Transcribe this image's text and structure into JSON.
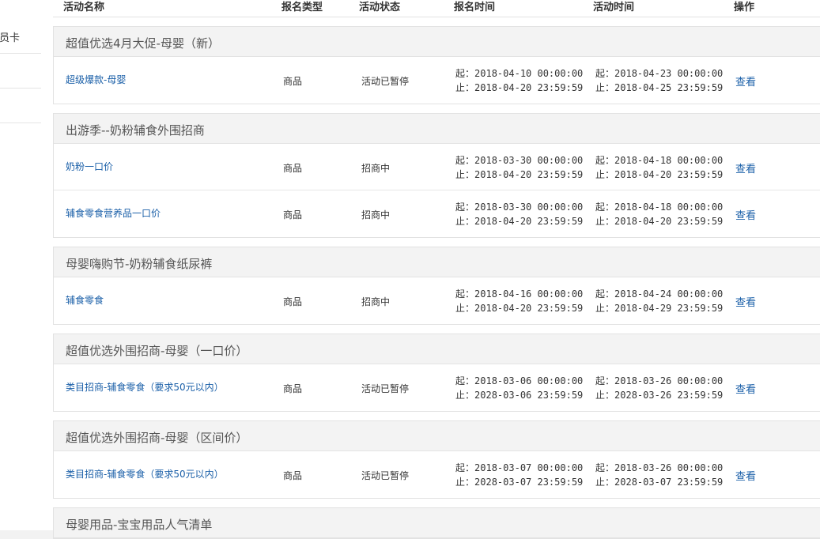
{
  "sidebar": {
    "items": [
      {
        "label": "会员卡"
      },
      {
        "label": ""
      },
      {
        "label": ""
      }
    ]
  },
  "table": {
    "headers": {
      "name": "活动名称",
      "type": "报名类型",
      "status": "活动状态",
      "reg_time": "报名时间",
      "act_time": "活动时间",
      "op": "操作"
    }
  },
  "labels": {
    "start": "起：",
    "end": "止："
  },
  "groups": [
    {
      "title": "超值优选4月大促-母婴（新）",
      "rows": [
        {
          "name": "超级爆款-母婴",
          "type": "商品",
          "status": "活动已暂停",
          "reg_start": "2018-04-10 00:00:00",
          "reg_end": "2018-04-20 23:59:59",
          "act_start": "2018-04-23 00:00:00",
          "act_end": "2018-04-25 23:59:59",
          "op": "查看"
        }
      ]
    },
    {
      "title": "出游季--奶粉辅食外围招商",
      "rows": [
        {
          "name": "奶粉一口价",
          "type": "商品",
          "status": "招商中",
          "reg_start": "2018-03-30 00:00:00",
          "reg_end": "2018-04-20 23:59:59",
          "act_start": "2018-04-18 00:00:00",
          "act_end": "2018-04-20 23:59:59",
          "op": "查看"
        },
        {
          "name": "辅食零食营养品一口价",
          "type": "商品",
          "status": "招商中",
          "reg_start": "2018-03-30 00:00:00",
          "reg_end": "2018-04-20 23:59:59",
          "act_start": "2018-04-18 00:00:00",
          "act_end": "2018-04-20 23:59:59",
          "op": "查看"
        }
      ]
    },
    {
      "title": "母婴嗨购节-奶粉辅食纸尿裤",
      "rows": [
        {
          "name": "辅食零食",
          "type": "商品",
          "status": "招商中",
          "reg_start": "2018-04-16 00:00:00",
          "reg_end": "2018-04-20 23:59:59",
          "act_start": "2018-04-24 00:00:00",
          "act_end": "2018-04-29 23:59:59",
          "op": "查看"
        }
      ]
    },
    {
      "title": "超值优选外围招商-母婴（一口价）",
      "rows": [
        {
          "name": "类目招商-辅食零食（要求50元以内）",
          "type": "商品",
          "status": "活动已暂停",
          "reg_start": "2018-03-06 00:00:00",
          "reg_end": "2028-03-06 23:59:59",
          "act_start": "2018-03-26 00:00:00",
          "act_end": "2028-03-26 23:59:59",
          "op": "查看"
        }
      ]
    },
    {
      "title": "超值优选外围招商-母婴（区间价）",
      "rows": [
        {
          "name": "类目招商-辅食零食（要求50元以内）",
          "type": "商品",
          "status": "活动已暂停",
          "reg_start": "2018-03-07 00:00:00",
          "reg_end": "2028-03-07 23:59:59",
          "act_start": "2018-03-26 00:00:00",
          "act_end": "2028-03-07 23:59:59",
          "op": "查看"
        }
      ]
    },
    {
      "title": "母婴用品-宝宝用品人气清单",
      "rows": []
    }
  ]
}
